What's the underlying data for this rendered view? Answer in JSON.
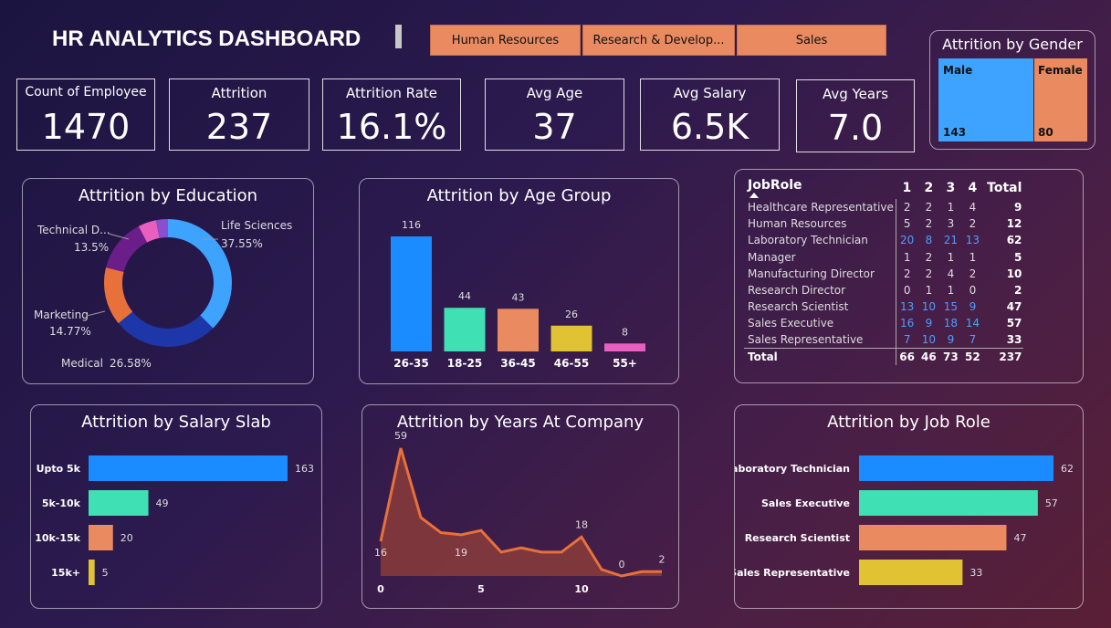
{
  "title": "HR ANALYTICS DASHBOARD",
  "slicers": [
    "Human Resources",
    "Research & Develop...",
    "Sales"
  ],
  "kpis": [
    {
      "label": "Count of Employee",
      "value": "1470"
    },
    {
      "label": "Attrition",
      "value": "237"
    },
    {
      "label": "Attrition Rate",
      "value": "16.1%"
    },
    {
      "label": "Avg Age",
      "value": "37"
    },
    {
      "label": "Avg Salary",
      "value": "6.5K"
    },
    {
      "label": "Avg Years",
      "value": "7.0"
    }
  ],
  "colors": {
    "blue": "#1a8cff",
    "teal": "#3ee0b4",
    "orange": "#ea8a60",
    "yellow": "#e0c232",
    "pink": "#e85fbf",
    "navy": "#1d36a8",
    "purple": "#6b1d8a",
    "lightblue": "#3ea2ff"
  },
  "chart_data": [
    {
      "id": "gender",
      "type": "treemap",
      "title": "Attrition by Gender",
      "categories": [
        "Male",
        "Female"
      ],
      "values": [
        143,
        80
      ]
    },
    {
      "id": "education",
      "type": "pie",
      "title": "Attrition by Education",
      "slices": [
        {
          "name": "Life Sciences",
          "value": 37.55,
          "label": "37.55%"
        },
        {
          "name": "Medical",
          "value": 26.58,
          "label": "26.58%"
        },
        {
          "name": "Marketing",
          "value": 14.77,
          "label": "14.77%"
        },
        {
          "name": "Technical D...",
          "value": 13.5,
          "label": "13.5%"
        },
        {
          "name": "",
          "value": 4.6,
          "label": ""
        },
        {
          "name": "",
          "value": 3.0,
          "label": ""
        }
      ]
    },
    {
      "id": "age",
      "type": "bar",
      "title": "Attrition by Age Group",
      "categories": [
        "26-35",
        "18-25",
        "36-45",
        "46-55",
        "55+"
      ],
      "values": [
        116,
        44,
        43,
        26,
        8
      ]
    },
    {
      "id": "jobrole_table",
      "type": "table",
      "header": [
        "JobRole",
        "1",
        "2",
        "3",
        "4",
        "Total"
      ],
      "rows": [
        [
          "Healthcare Representative",
          "2",
          "2",
          "1",
          "4",
          "9"
        ],
        [
          "Human Resources",
          "5",
          "2",
          "3",
          "2",
          "12"
        ],
        [
          "Laboratory Technician",
          "20",
          "8",
          "21",
          "13",
          "62"
        ],
        [
          "Manager",
          "1",
          "2",
          "1",
          "1",
          "5"
        ],
        [
          "Manufacturing Director",
          "2",
          "2",
          "4",
          "2",
          "10"
        ],
        [
          "Research Director",
          "0",
          "1",
          "1",
          "0",
          "2"
        ],
        [
          "Research Scientist",
          "13",
          "10",
          "15",
          "9",
          "47"
        ],
        [
          "Sales Executive",
          "16",
          "9",
          "18",
          "14",
          "57"
        ],
        [
          "Sales Representative",
          "7",
          "10",
          "9",
          "7",
          "33"
        ]
      ],
      "total": [
        "Total",
        "66",
        "46",
        "73",
        "52",
        "237"
      ]
    },
    {
      "id": "salary",
      "type": "bar",
      "orientation": "horizontal",
      "title": "Attrition by Salary Slab",
      "categories": [
        "Upto 5k",
        "5k-10k",
        "10k-15k",
        "15k+"
      ],
      "values": [
        163,
        49,
        20,
        5
      ]
    },
    {
      "id": "years",
      "type": "area",
      "title": "Attrition by Years At Company",
      "x": [
        0,
        1,
        2,
        3,
        4,
        5,
        6,
        7,
        8,
        9,
        10,
        11,
        12,
        13,
        14
      ],
      "values": [
        16,
        59,
        27,
        20,
        19,
        21,
        11,
        13,
        11,
        11,
        18,
        3,
        0,
        2,
        2
      ],
      "data_labels": [
        {
          "x": 0,
          "label": "16"
        },
        {
          "x": 1,
          "label": "59"
        },
        {
          "x": 4,
          "label": "19"
        },
        {
          "x": 10,
          "label": "18"
        },
        {
          "x": 12,
          "label": "0"
        },
        {
          "x": 14,
          "label": "2"
        }
      ],
      "xticks": [
        "0",
        "5",
        "10"
      ]
    },
    {
      "id": "jobrole",
      "type": "bar",
      "orientation": "horizontal",
      "title": "Attrition by Job Role",
      "categories": [
        "aboratory Technician",
        "Sales Executive",
        "Research Scientist",
        "Sales Representative"
      ],
      "values": [
        62,
        57,
        47,
        33
      ]
    }
  ]
}
